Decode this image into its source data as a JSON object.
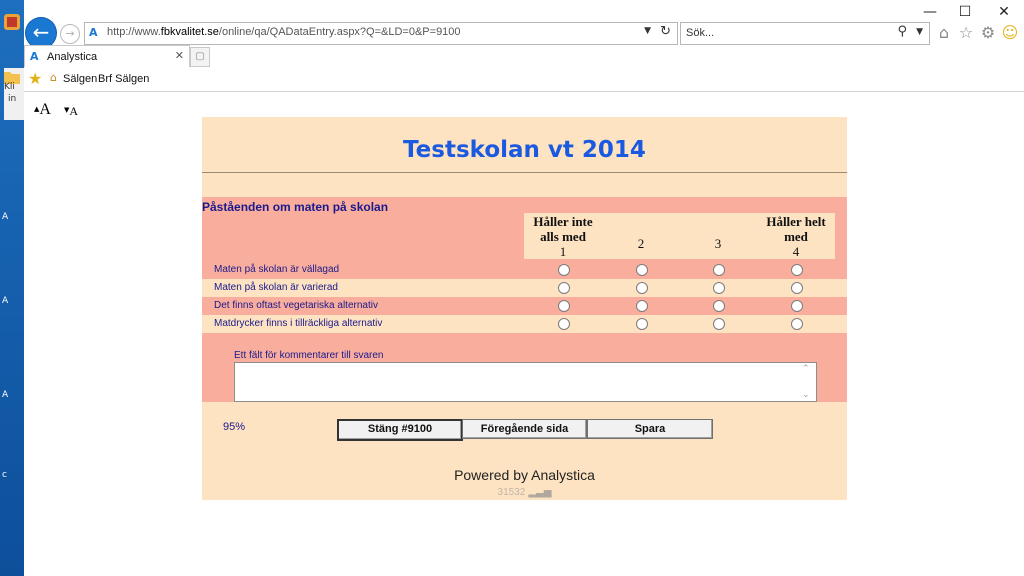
{
  "desktop": {
    "icon_labels": [
      "Kli",
      "in",
      "A",
      "A",
      "A",
      "c"
    ]
  },
  "browser": {
    "address_url_prefix": "http://www.",
    "address_url_domain": "fbkvalitet.se",
    "address_url_rest": "/online/qa/QADataEntry.aspx?Q=&LD=0&P=9100",
    "search_placeholder": "Sök...",
    "tab_label": "Analystica",
    "favorites": [
      "Sälgen",
      "Brf Sälgen"
    ]
  },
  "page": {
    "font_size_up": "A",
    "font_size_down": "A",
    "title": "Testskolan vt 2014",
    "question_heading": "Påståenden om maten på skolan",
    "scale": {
      "low_label_line1": "Håller inte",
      "low_label_line2": "alls med",
      "high_label_line1": "Håller helt",
      "high_label_line2": "med",
      "values": [
        "1",
        "2",
        "3",
        "4"
      ]
    },
    "statements": [
      "Maten på skolan är vällagad",
      "Maten på skolan är varierad",
      "Det finns oftast vegetariska alternativ",
      "Matdrycker finns i tillräckliga alternativ"
    ],
    "comment_label": "Ett fält för kommentarer till svaren",
    "comment_value": "",
    "progress": "95%",
    "buttons": {
      "close": "Stäng     #9100",
      "previous": "Föregående sida",
      "save": "Spara"
    },
    "powered_by": "Powered by Analystica",
    "counter": "31532"
  },
  "colors": {
    "title": "#1a5ae0",
    "panel_light": "#fde3c2",
    "panel_salmon": "#f9ad9d",
    "text_navy": "#1a1a8c",
    "ie_blue": "#1a78d2"
  }
}
